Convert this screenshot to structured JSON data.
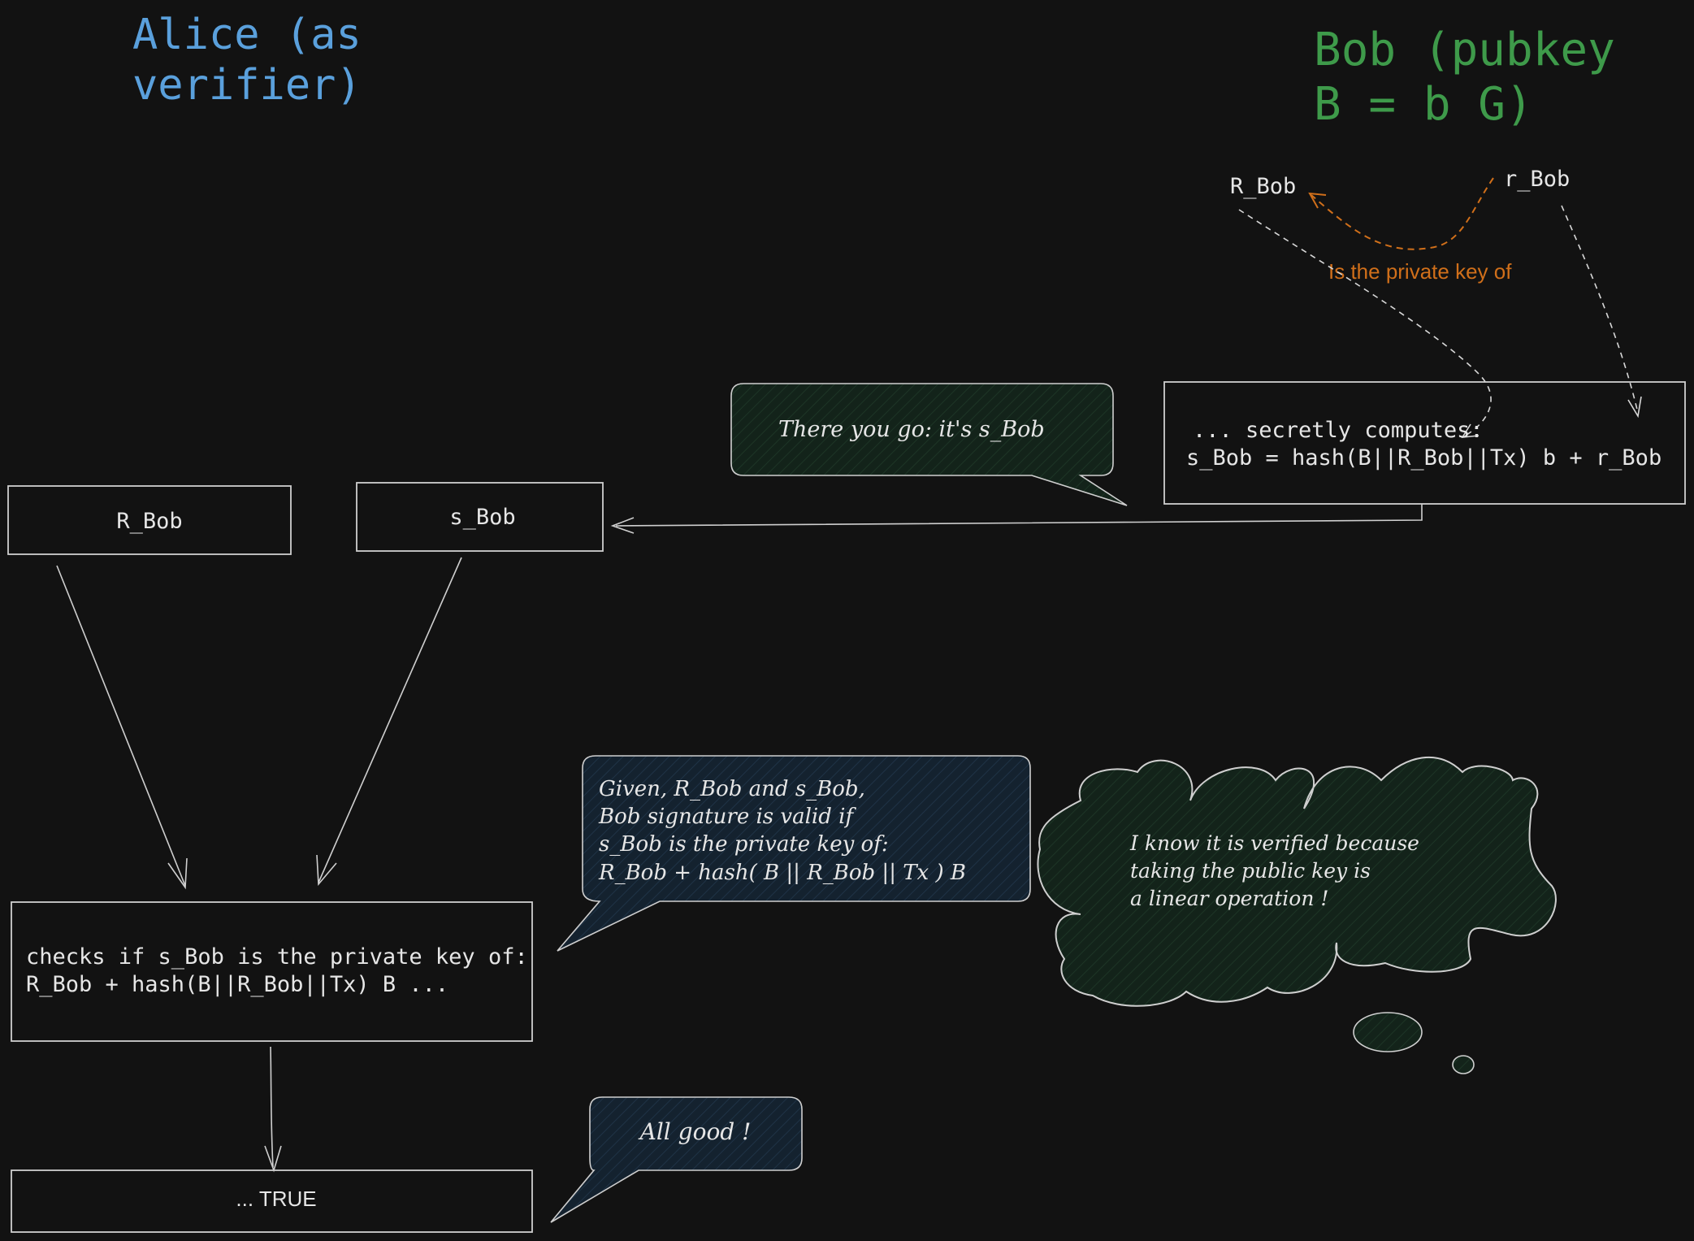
{
  "titles": {
    "alice": [
      "Alice (as",
      "verifier)"
    ],
    "bob": [
      "Bob (pubkey",
      "B = b G)"
    ]
  },
  "labels": {
    "r_bob_upper": "R_Bob",
    "r_bob_lower": "r_Bob",
    "private_key_relation": "Is the private key of"
  },
  "boxes": {
    "bob_compute": [
      "... secretly computes:",
      "s_Bob = hash(B||R_Bob||Tx) b + r_Bob"
    ],
    "alice_r_bob": "R_Bob",
    "alice_s_bob": "s_Bob",
    "checks": [
      "checks if s_Bob is the private key of:",
      "R_Bob + hash(B||R_Bob||Tx) B ..."
    ],
    "result": "... TRUE"
  },
  "bubbles": {
    "there_you_go": "There you go: it's s_Bob",
    "given": [
      "Given, R_Bob and s_Bob,",
      "Bob signature is valid if",
      "s_Bob is the private key of:",
      "R_Bob + hash( B || R_Bob || Tx ) B"
    ],
    "all_good": "All good !",
    "thought": [
      "I know it is verified because",
      "taking the public key is",
      "a linear operation !"
    ]
  },
  "colors": {
    "alice_title": "#5aa0dc",
    "bob_title": "#3e9a4a",
    "relation": "#d06f1a",
    "stroke": "#cfcfcf",
    "text": "#e6e6e6",
    "green_fill": "#13231a",
    "blue_fill": "#14222f",
    "background": "#121212"
  }
}
